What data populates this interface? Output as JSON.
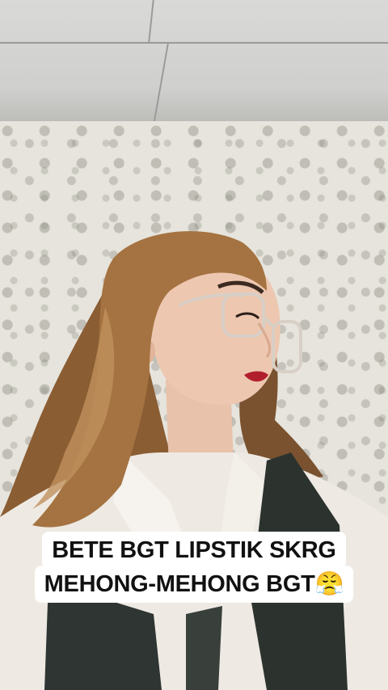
{
  "caption": {
    "line1": "BETE BGT LIPSTIK SKRG",
    "line2": "MEHONG-MEHONG BGT😤"
  },
  "colors": {
    "caption_bg": "#ffffff",
    "caption_text": "#111111",
    "ceiling": "#d6d6d4",
    "wallpaper": "#e6e4dc",
    "hair": "#a2703f",
    "shirt": "#efebe4",
    "vest": "#2e3430"
  }
}
